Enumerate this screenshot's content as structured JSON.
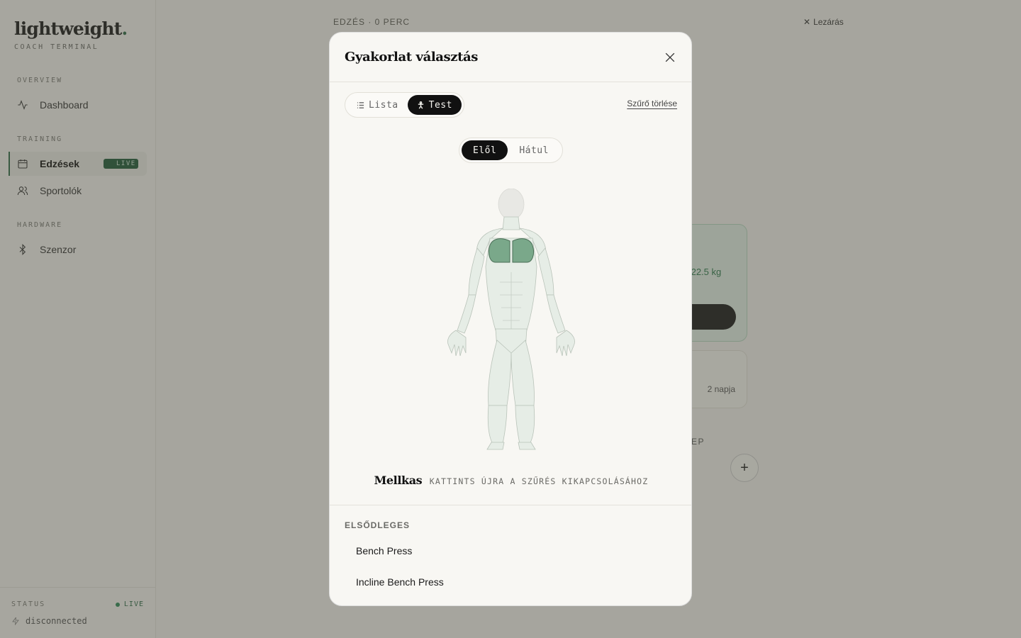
{
  "brand": {
    "logo": "lightweight",
    "logo_dot": ".",
    "subtitle": "COACH TERMINAL"
  },
  "sidebar": {
    "sections": [
      {
        "label": "OVERVIEW",
        "items": [
          {
            "label": "Dashboard",
            "icon": "activity-icon"
          }
        ]
      },
      {
        "label": "TRAINING",
        "items": [
          {
            "label": "Edzések",
            "icon": "calendar-icon",
            "active": true,
            "badge": "LIVE"
          },
          {
            "label": "Sportolók",
            "icon": "users-icon"
          }
        ]
      },
      {
        "label": "HARDWARE",
        "items": [
          {
            "label": "Szenzor",
            "icon": "bluetooth-icon"
          }
        ]
      }
    ],
    "status": {
      "label": "STATUS",
      "live": "LIVE",
      "connection": "disconnected"
    }
  },
  "main": {
    "top_label": "EDZÉS · 0 PERC",
    "close_label": "Lezárás",
    "card_weight": "+22.5 kg",
    "card_days": "2 napja",
    "step_label": "EP"
  },
  "modal": {
    "title": "Gyakorlat választás",
    "view_toggle": {
      "list": "Lista",
      "body": "Test",
      "active": "body"
    },
    "clear_filter": "Szűrő törlése",
    "side_toggle": {
      "front": "Elől",
      "back": "Hátul",
      "active": "front"
    },
    "selected_muscle": "Mellkas",
    "hint": "KATTINTS ÚJRA A SZŰRÉS KIKAPCSOLÁSÁHOZ",
    "list_heading": "ELSŐDLEGES",
    "exercises": [
      "Bench Press",
      "Incline Bench Press"
    ]
  },
  "colors": {
    "accent": "#2e6a48",
    "muscle_selected": "#7aa88a",
    "muscle_base": "#e6ede6"
  }
}
